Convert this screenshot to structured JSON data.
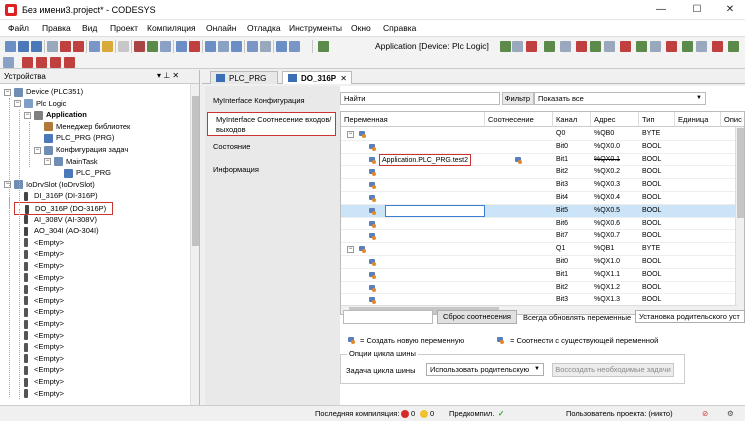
{
  "window": {
    "title": "Без имени3.project* - CODESYS",
    "minimize": "—",
    "maximize": "☐",
    "close": "✕"
  },
  "menu": [
    "Файл",
    "Правка",
    "Вид",
    "Проект",
    "Компиляция",
    "Онлайн",
    "Отладка",
    "Инструменты",
    "Окно",
    "Справка"
  ],
  "toolbar": {
    "device_label": "Application [Device: Plc Logic]"
  },
  "devices_pane": {
    "title": "Устройства",
    "pin": "▾ ⊥ ✕",
    "tree": [
      {
        "label": "Device (PLC351)",
        "level": 0,
        "toggle": "−",
        "icon": "device"
      },
      {
        "label": "Plc Logic",
        "level": 1,
        "toggle": "−",
        "icon": "logic"
      },
      {
        "label": "Application",
        "level": 2,
        "toggle": "−",
        "icon": "app",
        "bold": true
      },
      {
        "label": "Менеджер библиотек",
        "level": 3,
        "toggle": "",
        "icon": "lib"
      },
      {
        "label": "PLC_PRG (PRG)",
        "level": 3,
        "toggle": "",
        "icon": "prg"
      },
      {
        "label": "Конфигурация задач",
        "level": 3,
        "toggle": "−",
        "icon": "task"
      },
      {
        "label": "MainTask",
        "level": 4,
        "toggle": "−",
        "icon": "task"
      },
      {
        "label": "PLC_PRG",
        "level": 5,
        "toggle": "",
        "icon": "prg"
      },
      {
        "label": "IoDrvSlot (IoDrvSlot)",
        "level": 0,
        "toggle": "−",
        "icon": "slot"
      },
      {
        "label": "DI_316P (DI-316P)",
        "level": 1,
        "toggle": "",
        "icon": "io"
      },
      {
        "label": "DO_316P (DO-316P)",
        "level": 1,
        "toggle": "",
        "icon": "io",
        "highlight": true
      },
      {
        "label": "AI_308V (AI-308V)",
        "level": 1,
        "toggle": "",
        "icon": "io"
      },
      {
        "label": "AO_304I (AO-304I)",
        "level": 1,
        "toggle": "",
        "icon": "io"
      },
      {
        "label": "<Empty>",
        "level": 1,
        "toggle": "",
        "icon": "empty"
      },
      {
        "label": "<Empty>",
        "level": 1,
        "toggle": "",
        "icon": "empty"
      },
      {
        "label": "<Empty>",
        "level": 1,
        "toggle": "",
        "icon": "empty"
      },
      {
        "label": "<Empty>",
        "level": 1,
        "toggle": "",
        "icon": "empty"
      },
      {
        "label": "<Empty>",
        "level": 1,
        "toggle": "",
        "icon": "empty"
      },
      {
        "label": "<Empty>",
        "level": 1,
        "toggle": "",
        "icon": "empty"
      },
      {
        "label": "<Empty>",
        "level": 1,
        "toggle": "",
        "icon": "empty"
      },
      {
        "label": "<Empty>",
        "level": 1,
        "toggle": "",
        "icon": "empty"
      },
      {
        "label": "<Empty>",
        "level": 1,
        "toggle": "",
        "icon": "empty"
      },
      {
        "label": "<Empty>",
        "level": 1,
        "toggle": "",
        "icon": "empty"
      },
      {
        "label": "<Empty>",
        "level": 1,
        "toggle": "",
        "icon": "empty"
      },
      {
        "label": "<Empty>",
        "level": 1,
        "toggle": "",
        "icon": "empty"
      },
      {
        "label": "<Empty>",
        "level": 1,
        "toggle": "",
        "icon": "empty"
      },
      {
        "label": "<Empty>",
        "level": 1,
        "toggle": "",
        "icon": "empty"
      }
    ]
  },
  "editor_tabs": [
    {
      "label": "PLC_PRG",
      "active": false,
      "close": ""
    },
    {
      "label": "DO_316P",
      "active": true,
      "close": "✕"
    }
  ],
  "subnav": [
    {
      "label": "MyInterface Конфигурация",
      "selected": false
    },
    {
      "label": "MyInterface Соотнесение входов/выходов",
      "selected": true
    },
    {
      "label": "Состояние",
      "selected": false
    },
    {
      "label": "Информация",
      "selected": false
    }
  ],
  "filter": {
    "search_label": "Найти",
    "filter_label": "Фильтр",
    "filter_value": "Показать все"
  },
  "grid": {
    "columns": [
      "Переменная",
      "Соотнесение",
      "Канал",
      "Адрес",
      "Тип",
      "Единица",
      "Опис"
    ],
    "rows": [
      {
        "expand": "−",
        "variable": "",
        "mapping": "",
        "channel": "Q0",
        "address": "%QB0",
        "type": "BYTE",
        "depth": 0,
        "strike": false,
        "selected": false
      },
      {
        "expand": "",
        "variable": "",
        "mapping": "",
        "channel": "Bit0",
        "address": "%QX0.0",
        "type": "BOOL",
        "depth": 1,
        "strike": false,
        "selected": false
      },
      {
        "expand": "",
        "variable": "Application.PLC_PRG.test2",
        "mapping": "mapped",
        "channel": "Bit1",
        "address": "%QX0.1",
        "type": "BOOL",
        "depth": 1,
        "strike": true,
        "selected": false
      },
      {
        "expand": "",
        "variable": "",
        "mapping": "",
        "channel": "Bit2",
        "address": "%QX0.2",
        "type": "BOOL",
        "depth": 1,
        "strike": false,
        "selected": false
      },
      {
        "expand": "",
        "variable": "",
        "mapping": "",
        "channel": "Bit3",
        "address": "%QX0.3",
        "type": "BOOL",
        "depth": 1,
        "strike": false,
        "selected": false
      },
      {
        "expand": "",
        "variable": "",
        "mapping": "",
        "channel": "Bit4",
        "address": "%QX0.4",
        "type": "BOOL",
        "depth": 1,
        "strike": false,
        "selected": false
      },
      {
        "expand": "",
        "variable": "",
        "mapping": "",
        "channel": "Bit5",
        "address": "%QX0.5",
        "type": "BOOL",
        "depth": 1,
        "strike": false,
        "selected": true
      },
      {
        "expand": "",
        "variable": "",
        "mapping": "",
        "channel": "Bit6",
        "address": "%QX0.6",
        "type": "BOOL",
        "depth": 1,
        "strike": false,
        "selected": false
      },
      {
        "expand": "",
        "variable": "",
        "mapping": "",
        "channel": "Bit7",
        "address": "%QX0.7",
        "type": "BOOL",
        "depth": 1,
        "strike": false,
        "selected": false
      },
      {
        "expand": "−",
        "variable": "",
        "mapping": "",
        "channel": "Q1",
        "address": "%QB1",
        "type": "BYTE",
        "depth": 0,
        "strike": false,
        "selected": false
      },
      {
        "expand": "",
        "variable": "",
        "mapping": "",
        "channel": "Bit0",
        "address": "%QX1.0",
        "type": "BOOL",
        "depth": 1,
        "strike": false,
        "selected": false
      },
      {
        "expand": "",
        "variable": "",
        "mapping": "",
        "channel": "Bit1",
        "address": "%QX1.1",
        "type": "BOOL",
        "depth": 1,
        "strike": false,
        "selected": false
      },
      {
        "expand": "",
        "variable": "",
        "mapping": "",
        "channel": "Bit2",
        "address": "%QX1.2",
        "type": "BOOL",
        "depth": 1,
        "strike": false,
        "selected": false
      },
      {
        "expand": "",
        "variable": "",
        "mapping": "",
        "channel": "Bit3",
        "address": "%QX1.3",
        "type": "BOOL",
        "depth": 1,
        "strike": false,
        "selected": false
      }
    ]
  },
  "actions": {
    "reset_mapping": "Сброс соотнесения",
    "always_update": "Всегда обновлять переменные",
    "parent_setting": "Установка родительского уст"
  },
  "legend": {
    "new_var": "= Создать новую переменную",
    "existing_var": "= Соотнести с существующей переменной"
  },
  "cycle": {
    "group_title": "Опции цикла шины",
    "task_label": "Задача цикла шины",
    "task_value": "Использовать родительскую",
    "apply_button": "Воссоздать необходимые задачи"
  },
  "status": {
    "last_build": "Последняя компиляция:",
    "errors": "0",
    "warnings": "0",
    "precompile": "Предкомпил.",
    "project_user": "Пользователь проекта: (никто)"
  },
  "colors": {
    "highlight_red": "#cc3333",
    "selection_blue": "#cce4f7",
    "accent_blue": "#3a6fb5"
  }
}
